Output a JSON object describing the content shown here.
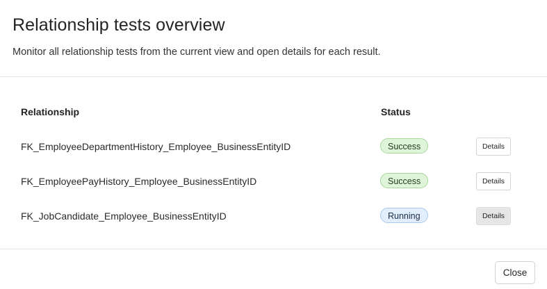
{
  "dialog": {
    "title": "Relationship tests overview",
    "subtitle": "Monitor all relationship tests from the current view and open details for each result."
  },
  "table": {
    "columns": {
      "relationship": "Relationship",
      "status": "Status"
    },
    "rows": [
      {
        "relationship": "FK_EmployeeDepartmentHistory_Employee_BusinessEntityID",
        "status": "Success",
        "details_label": "Details"
      },
      {
        "relationship": "FK_EmployeePayHistory_Employee_BusinessEntityID",
        "status": "Success",
        "details_label": "Details"
      },
      {
        "relationship": "FK_JobCandidate_Employee_BusinessEntityID",
        "status": "Running",
        "details_label": "Details"
      }
    ]
  },
  "footer": {
    "close_label": "Close"
  },
  "colors": {
    "success_bg": "#dff4d9",
    "success_border": "#a6d99a",
    "running_bg": "#e2eefb",
    "running_border": "#a9c8ee"
  }
}
